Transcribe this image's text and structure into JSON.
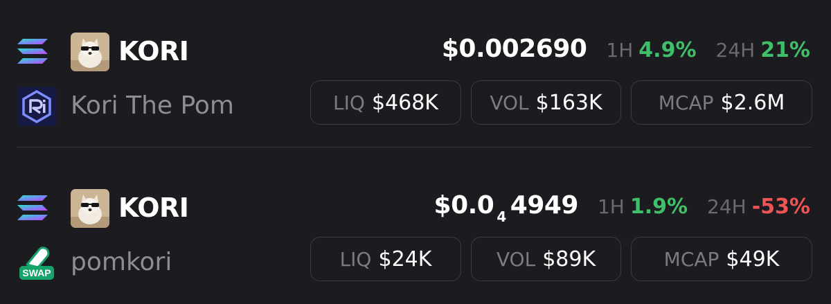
{
  "tokens": [
    {
      "symbol": "KORI",
      "name": "Kori The Pom",
      "chain_icon": "solana-icon",
      "dex_icon": "raydium-icon",
      "price": {
        "prefix": "$0.002690",
        "subscript": "",
        "rest": ""
      },
      "change_1h": {
        "label": "1H",
        "value": "4.9%",
        "status": "positive"
      },
      "change_24h": {
        "label": "24H",
        "value": "21%",
        "status": "positive"
      },
      "stats": {
        "liq": {
          "label": "LIQ",
          "value": "$468K"
        },
        "vol": {
          "label": "VOL",
          "value": "$163K"
        },
        "mcap": {
          "label": "MCAP",
          "value": "$2.6M"
        }
      }
    },
    {
      "symbol": "KORI",
      "name": "pomkori",
      "chain_icon": "solana-icon",
      "dex_icon": "swap-icon",
      "dex_icon_text": "SWAP",
      "price": {
        "prefix": "$0.0",
        "subscript": "4",
        "rest": "4949"
      },
      "change_1h": {
        "label": "1H",
        "value": "1.9%",
        "status": "positive"
      },
      "change_24h": {
        "label": "24H",
        "value": "-53%",
        "status": "negative"
      },
      "stats": {
        "liq": {
          "label": "LIQ",
          "value": "$24K"
        },
        "vol": {
          "label": "VOL",
          "value": "$89K"
        },
        "mcap": {
          "label": "MCAP",
          "value": "$49K"
        }
      }
    }
  ],
  "colors": {
    "background": "#1c1b1f",
    "positive": "#3fbf6a",
    "negative": "#ee5454",
    "muted": "#8e8d93",
    "border": "#3c3b40"
  }
}
